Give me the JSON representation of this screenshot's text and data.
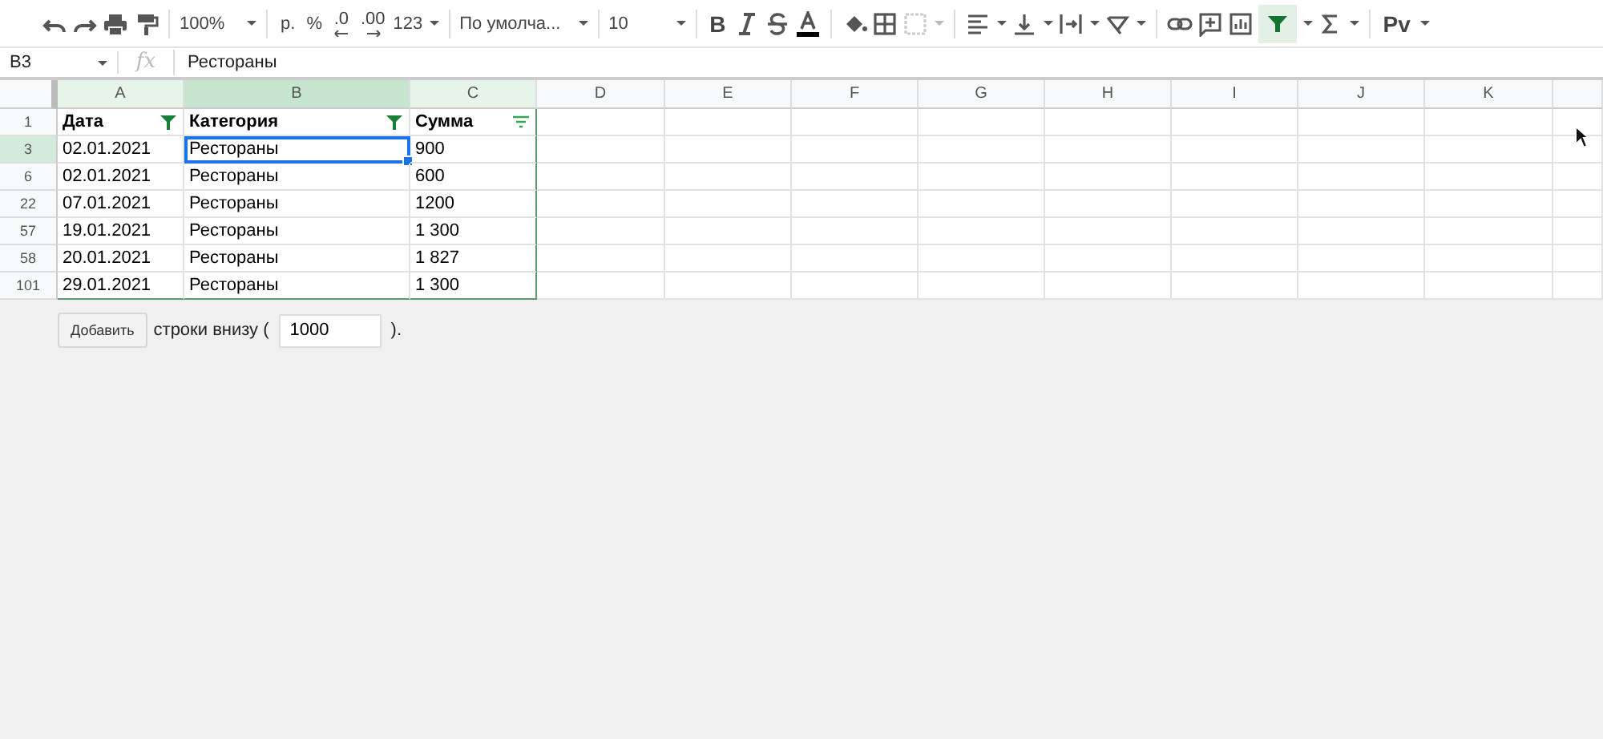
{
  "toolbar": {
    "zoom": "100%",
    "currency": "р.",
    "percent": "%",
    "decrease_decimals": ".0",
    "increase_decimals": ".00",
    "number_format": "123",
    "font": "По умолча...",
    "font_size": "10",
    "bold": "B",
    "filter_selected": true,
    "input_tools": "Рv"
  },
  "formula_bar": {
    "cell_ref": "B3",
    "fx": "fx",
    "value": "Рестораны"
  },
  "columns": [
    {
      "label": "A",
      "selected": false
    },
    {
      "label": "B",
      "selected": true
    },
    {
      "label": "C",
      "selected": false
    },
    {
      "label": "D",
      "selected": false
    },
    {
      "label": "E",
      "selected": false
    },
    {
      "label": "F",
      "selected": false
    },
    {
      "label": "G",
      "selected": false
    },
    {
      "label": "H",
      "selected": false
    },
    {
      "label": "I",
      "selected": false
    },
    {
      "label": "J",
      "selected": false
    },
    {
      "label": "K",
      "selected": false
    }
  ],
  "rows": [
    {
      "number": "1",
      "selected": false,
      "header": true,
      "cells": [
        {
          "text": "Дата",
          "filter_applied": true
        },
        {
          "text": "Категория",
          "filter_applied": true
        },
        {
          "text": "Сумма",
          "filter_applied": false
        }
      ]
    },
    {
      "number": "3",
      "selected": true,
      "header": false,
      "cells": [
        {
          "text": "02.01.2021"
        },
        {
          "text": "Рестораны",
          "selected": true
        },
        {
          "text": "900"
        }
      ]
    },
    {
      "number": "6",
      "selected": false,
      "header": false,
      "cells": [
        {
          "text": "02.01.2021"
        },
        {
          "text": "Рестораны"
        },
        {
          "text": "600"
        }
      ]
    },
    {
      "number": "22",
      "selected": false,
      "header": false,
      "cells": [
        {
          "text": "07.01.2021"
        },
        {
          "text": "Рестораны"
        },
        {
          "text": "1200"
        }
      ]
    },
    {
      "number": "57",
      "selected": false,
      "header": false,
      "cells": [
        {
          "text": "19.01.2021"
        },
        {
          "text": "Рестораны"
        },
        {
          "text": "1 300"
        }
      ]
    },
    {
      "number": "58",
      "selected": false,
      "header": false,
      "cells": [
        {
          "text": "20.01.2021"
        },
        {
          "text": "Рестораны"
        },
        {
          "text": "1 827"
        }
      ]
    },
    {
      "number": "101",
      "selected": false,
      "header": false,
      "cells": [
        {
          "text": "29.01.2021"
        },
        {
          "text": "Рестораны"
        },
        {
          "text": "1 300"
        }
      ]
    }
  ],
  "add_rows": {
    "button": "Добавить",
    "label": "строки внизу (",
    "count": "1000",
    "suffix": ")."
  }
}
